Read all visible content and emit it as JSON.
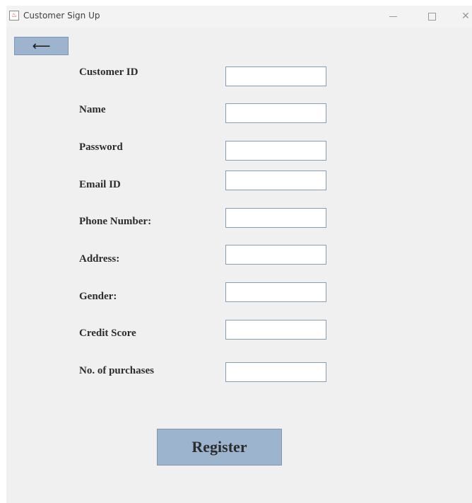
{
  "window": {
    "title": "Customer Sign Up",
    "icon": "java-cup-icon",
    "controls": {
      "minimize": "minimize-icon",
      "maximize": "maximize-icon",
      "close": "close-icon"
    }
  },
  "back_button": {
    "label": "⟵",
    "icon": "arrow-left-icon"
  },
  "form": {
    "fields": [
      {
        "label": "Customer ID",
        "value": ""
      },
      {
        "label": "Name",
        "value": ""
      },
      {
        "label": "Password",
        "value": ""
      },
      {
        "label": "Email ID",
        "value": ""
      },
      {
        "label": "Phone Number:",
        "value": ""
      },
      {
        "label": "Address:",
        "value": ""
      },
      {
        "label": "Gender:",
        "value": ""
      },
      {
        "label": "Credit Score",
        "value": ""
      },
      {
        "label": "No. of purchases",
        "value": ""
      }
    ]
  },
  "register_button": {
    "label": "Register"
  },
  "colors": {
    "button_bg": "#9db4cf",
    "window_bg": "#f0f0f0",
    "input_border": "#8a9bb4"
  }
}
